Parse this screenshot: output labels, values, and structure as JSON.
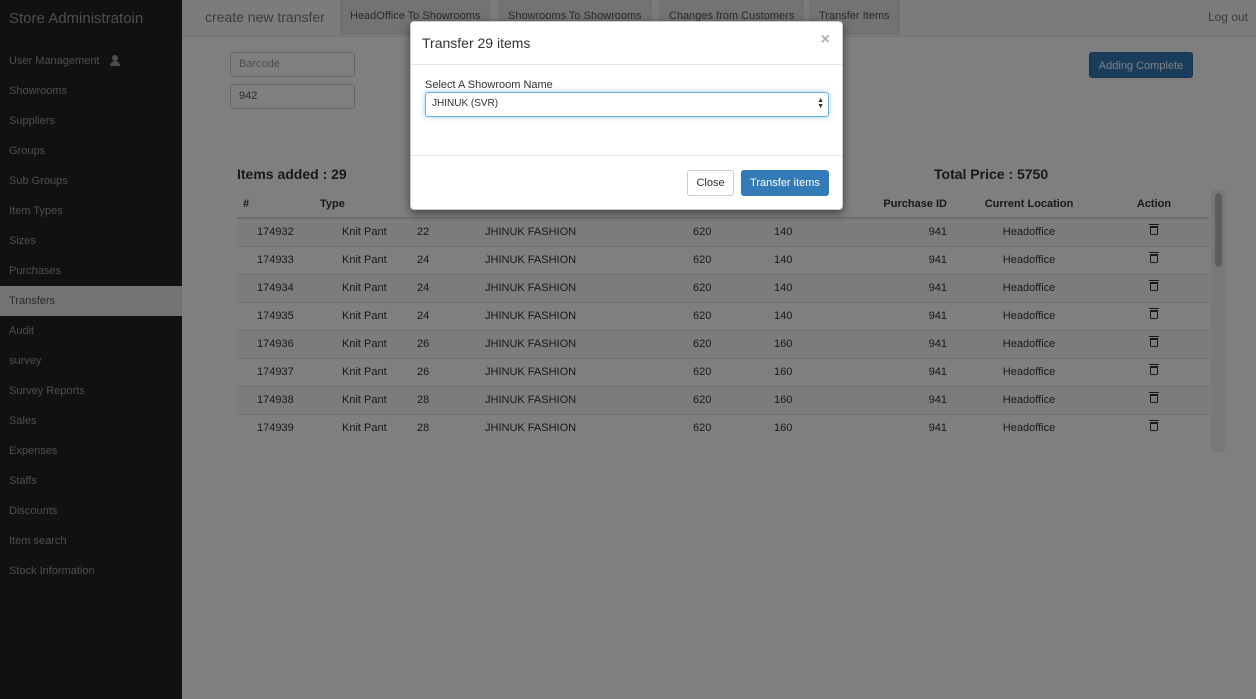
{
  "sidebar": {
    "brand": "Store Administratoin",
    "items": [
      {
        "label": "User Management",
        "icon": "user-icon"
      },
      {
        "label": "Showrooms"
      },
      {
        "label": "Suppliers"
      },
      {
        "label": "Groups"
      },
      {
        "label": "Sub Groups"
      },
      {
        "label": "Item Types"
      },
      {
        "label": "Sizes"
      },
      {
        "label": "Purchases"
      },
      {
        "label": "Transfers",
        "active": true
      },
      {
        "label": "Audit"
      },
      {
        "label": "survey"
      },
      {
        "label": "Survey Reports"
      },
      {
        "label": "Sales"
      },
      {
        "label": "Expenses"
      },
      {
        "label": "Staffs"
      },
      {
        "label": "Discounts"
      },
      {
        "label": "Item search"
      },
      {
        "label": "Stock Information"
      }
    ]
  },
  "topbar": {
    "heading": "create new transfer",
    "tabs": [
      "HeadOffice To Showrooms",
      "Showrooms To Showrooms",
      "Changes from Customers",
      "Transfer Items"
    ],
    "logout": "Log out"
  },
  "form": {
    "barcode_placeholder": "Barcode",
    "purchase_value": "942",
    "complete_label": "Adding Complete"
  },
  "summary": {
    "items_added": "Items added : 29",
    "total_price": "Total Price : 5750"
  },
  "table": {
    "headers": [
      "#",
      "Type",
      "",
      "",
      "",
      "",
      "Purchase ID",
      "Current Location",
      "Action"
    ],
    "rows": [
      [
        "174932",
        "Knit Pant",
        "22",
        "JHINUK FASHION",
        "620",
        "140",
        "941",
        "Headoffice"
      ],
      [
        "174933",
        "Knit Pant",
        "24",
        "JHINUK FASHION",
        "620",
        "140",
        "941",
        "Headoffice"
      ],
      [
        "174934",
        "Knit Pant",
        "24",
        "JHINUK FASHION",
        "620",
        "140",
        "941",
        "Headoffice"
      ],
      [
        "174935",
        "Knit Pant",
        "24",
        "JHINUK FASHION",
        "620",
        "140",
        "941",
        "Headoffice"
      ],
      [
        "174936",
        "Knit Pant",
        "26",
        "JHINUK FASHION",
        "620",
        "160",
        "941",
        "Headoffice"
      ],
      [
        "174937",
        "Knit Pant",
        "26",
        "JHINUK FASHION",
        "620",
        "160",
        "941",
        "Headoffice"
      ],
      [
        "174938",
        "Knit Pant",
        "28",
        "JHINUK FASHION",
        "620",
        "160",
        "941",
        "Headoffice"
      ],
      [
        "174939",
        "Knit Pant",
        "28",
        "JHINUK FASHION",
        "620",
        "160",
        "941",
        "Headoffice"
      ]
    ]
  },
  "modal": {
    "title": "Transfer 29 items",
    "close_symbol": "×",
    "select_label": "Select A Showroom Name",
    "selected": "JHINUK (SVR)",
    "close_button": "Close",
    "transfer_button": "Transfer items"
  }
}
